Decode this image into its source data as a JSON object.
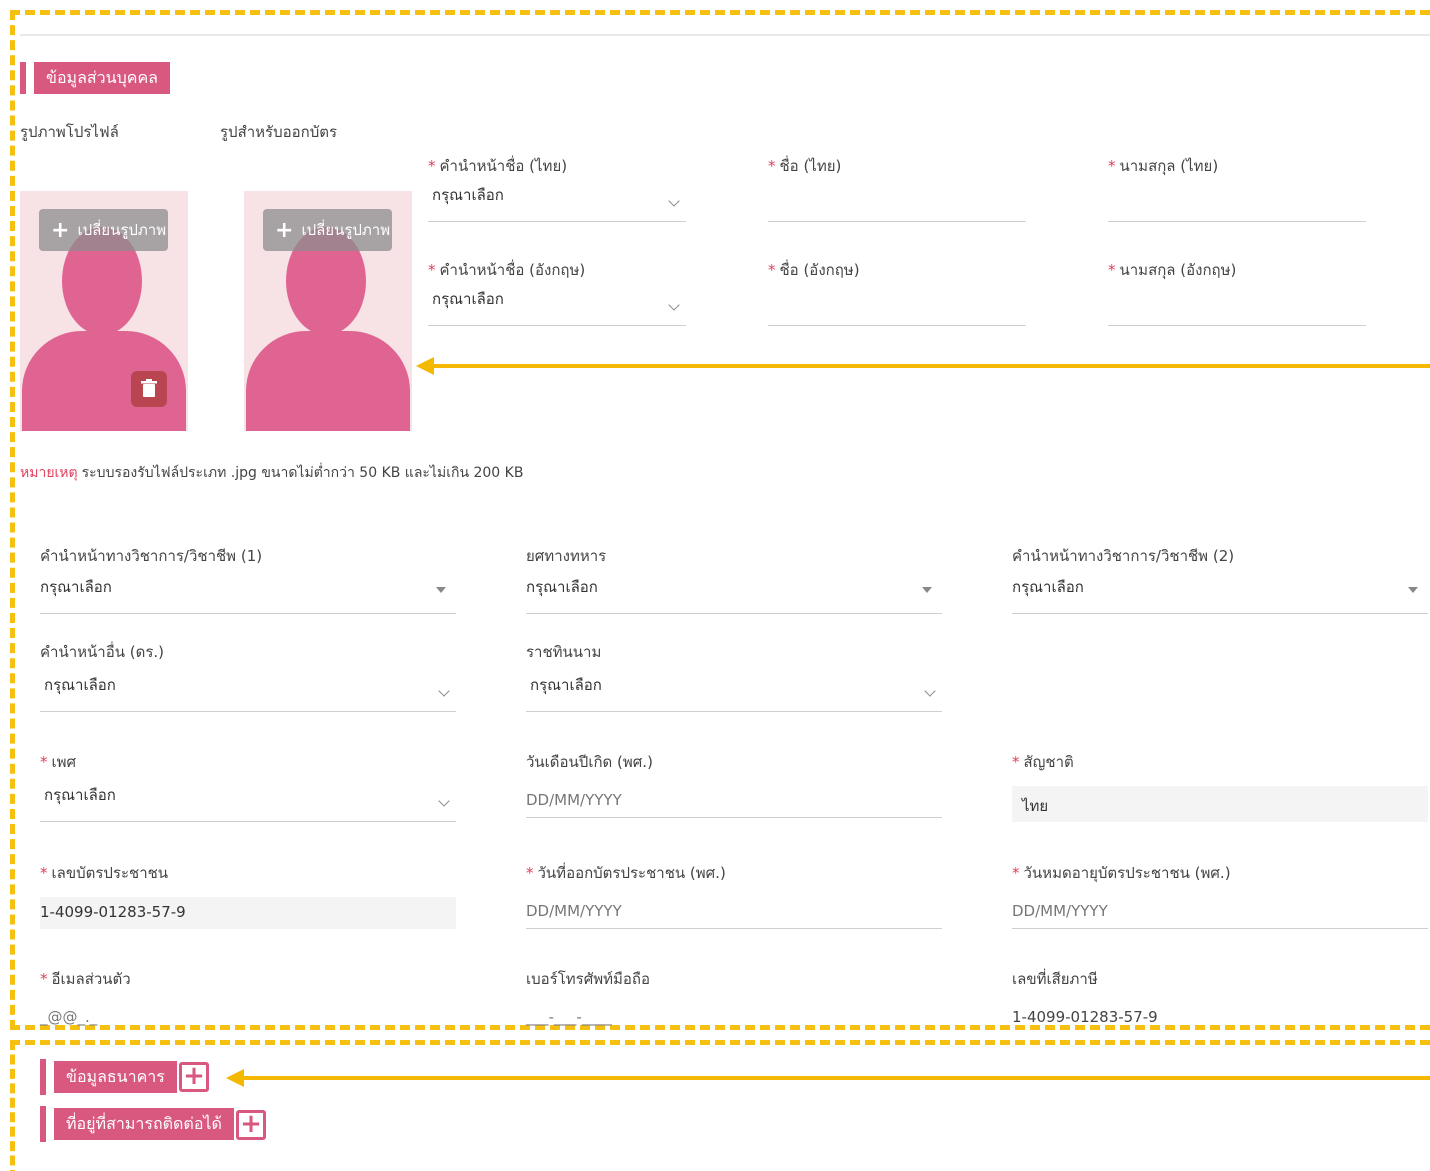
{
  "personal_section": {
    "title": "ข้อมูลส่วนบุคคล"
  },
  "photos": {
    "profile_label": "รูปภาพโปรไฟล์",
    "card_label": "รูปสำหรับออกบัตร",
    "change_button": "เปลี่ยนรูปภาพ"
  },
  "names": {
    "prefix_th": {
      "label": "คำนำหน้าชื่อ (ไทย)",
      "value": "กรุณาเลือก"
    },
    "first_th": {
      "label": "ชื่อ (ไทย)",
      "value": ""
    },
    "last_th": {
      "label": "นามสกุล (ไทย)",
      "value": ""
    },
    "prefix_en": {
      "label": "คำนำหน้าชื่อ (อังกฤษ)",
      "value": "กรุณาเลือก"
    },
    "first_en": {
      "label": "ชื่อ (อังกฤษ)",
      "value": ""
    },
    "last_en": {
      "label": "นามสกุล (อังกฤษ)",
      "value": ""
    }
  },
  "note": {
    "highlight": "หมายเหตุ",
    "text": "ระบบรองรับไฟล์ประเภท .jpg ขนาดไม่ต่ำกว่า 50 KB และไม่เกิน 200 KB"
  },
  "fields": {
    "academic_prefix_1": {
      "label": "คำนำหน้าทางวิชาการ/วิชาชีพ (1)",
      "value": "กรุณาเลือก"
    },
    "military_rank": {
      "label": "ยศทางทหาร",
      "value": "กรุณาเลือก"
    },
    "academic_prefix_2": {
      "label": "คำนำหน้าทางวิชาการ/วิชาชีพ (2)",
      "value": "กรุณาเลือก"
    },
    "other_prefix": {
      "label": "คำนำหน้าอื่น (ดร.)",
      "value": "กรุณาเลือก"
    },
    "royal_title": {
      "label": "ราชทินนาม",
      "value": "กรุณาเลือก"
    },
    "gender": {
      "label": "เพศ",
      "value": "กรุณาเลือก"
    },
    "birth_date": {
      "label": "วันเดือนปีเกิด (พศ.)",
      "value": "DD/MM/YYYY"
    },
    "nationality": {
      "label": "สัญชาติ",
      "value": "ไทย"
    },
    "citizen_id": {
      "label": "เลขบัตรประชาชน",
      "value": "1-4099-01283-57-9"
    },
    "id_issue_date": {
      "label": "วันที่ออกบัตรประชาชน (พศ.)",
      "value": "DD/MM/YYYY"
    },
    "id_expiry_date": {
      "label": "วันหมดอายุบัตรประชาชน (พศ.)",
      "value": "DD/MM/YYYY"
    },
    "email": {
      "label": "อีเมลส่วนตัว",
      "value": "_@@_._"
    },
    "mobile": {
      "label": "เบอร์โทรศัพท์มือถือ",
      "value": "___-___-____"
    },
    "tax_id": {
      "label": "เลขที่เสียภาษี",
      "value": "1-4099-01283-57-9"
    }
  },
  "bank_section": {
    "title": "ข้อมูลธนาคาร"
  },
  "address_section": {
    "title": "ที่อยู่ที่สามารถติดต่อได้"
  },
  "colors": {
    "accent": "#d9587f",
    "annotation": "#f5c010",
    "silhouette": "#e06492"
  }
}
